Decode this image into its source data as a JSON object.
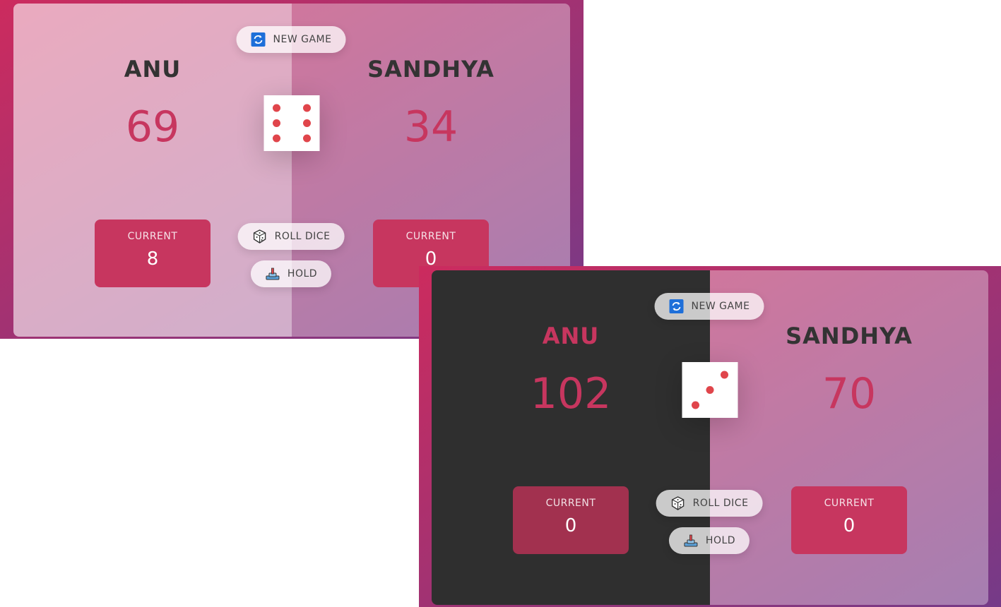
{
  "screens": [
    {
      "players": [
        {
          "name": "ANU",
          "score": "69",
          "current_label": "CURRENT",
          "current": "8",
          "state": "active"
        },
        {
          "name": "SANDHYA",
          "score": "34",
          "current_label": "CURRENT",
          "current": "0",
          "state": "idle"
        }
      ],
      "dice_value": 6,
      "buttons": {
        "new_game": "NEW GAME",
        "roll_dice": "ROLL DICE",
        "hold": "HOLD"
      }
    },
    {
      "players": [
        {
          "name": "ANU",
          "score": "102",
          "current_label": "CURRENT",
          "current": "0",
          "state": "winner"
        },
        {
          "name": "SANDHYA",
          "score": "70",
          "current_label": "CURRENT",
          "current": "0",
          "state": "idle"
        }
      ],
      "dice_value": 3,
      "buttons": {
        "new_game": "NEW GAME",
        "roll_dice": "ROLL DICE",
        "hold": "HOLD"
      }
    }
  ],
  "colors": {
    "accent": "#c7365f",
    "dice_dot": "#e0454b",
    "winner_panel": "#2f2f2f"
  },
  "icons": {
    "new_game": "refresh-icon",
    "roll_dice": "dice-icon",
    "hold": "hold-lever-icon"
  }
}
